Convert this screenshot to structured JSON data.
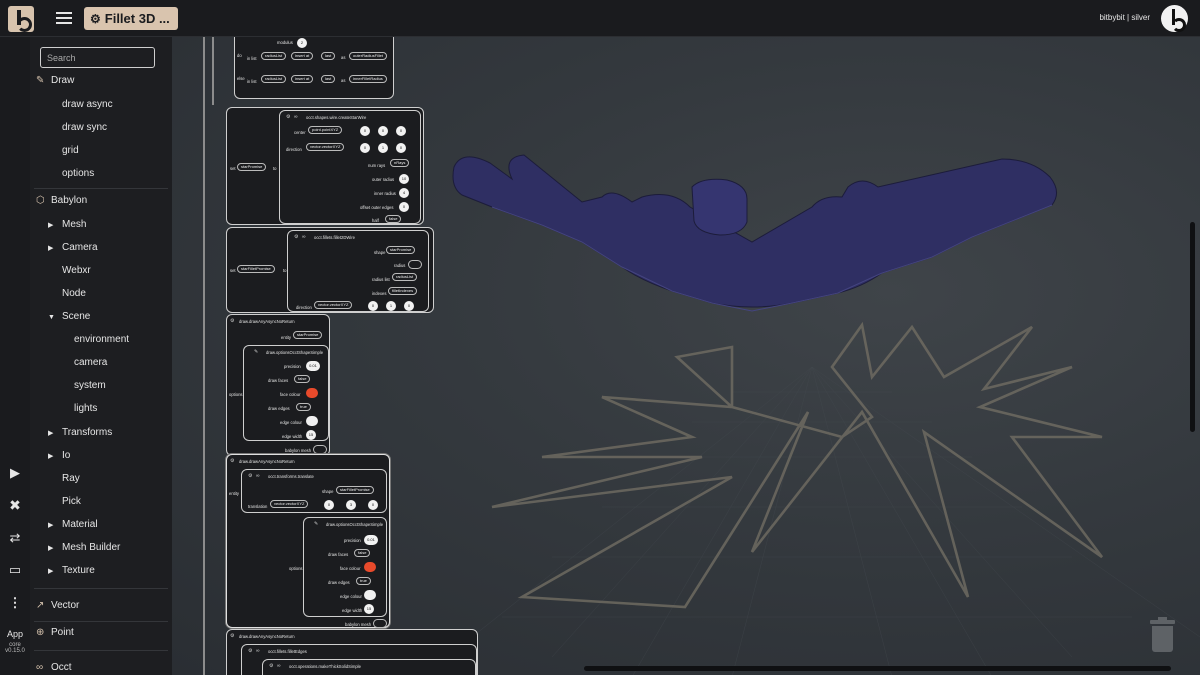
{
  "header": {
    "app_title": "Fillet 3D ...",
    "user": "bitbybit | silver"
  },
  "rail": {
    "app_label": "App",
    "core_label": "core",
    "version": "v0.15.0"
  },
  "sidebar": {
    "search_placeholder": "Search",
    "items": [
      {
        "label": "Draw"
      },
      {
        "label": "draw async"
      },
      {
        "label": "draw sync"
      },
      {
        "label": "grid"
      },
      {
        "label": "options"
      },
      {
        "label": "Babylon"
      },
      {
        "label": "Mesh"
      },
      {
        "label": "Camera"
      },
      {
        "label": "Webxr"
      },
      {
        "label": "Node"
      },
      {
        "label": "Scene"
      },
      {
        "label": "environment"
      },
      {
        "label": "camera"
      },
      {
        "label": "system"
      },
      {
        "label": "lights"
      },
      {
        "label": "Transforms"
      },
      {
        "label": "Io"
      },
      {
        "label": "Ray"
      },
      {
        "label": "Pick"
      },
      {
        "label": "Material"
      },
      {
        "label": "Mesh Builder"
      },
      {
        "label": "Texture"
      },
      {
        "label": "Vector"
      },
      {
        "label": "Point"
      },
      {
        "label": "Occt"
      }
    ]
  },
  "blocks": {
    "modulus": "modulus",
    "in_list": "in list",
    "insert_at": "insert at",
    "last": "last",
    "as": "as",
    "outer_radius_fillet": "outerRadiusFillet",
    "radius_list": "radiusList",
    "inner_radius_fillet": "innerFilletRadius",
    "do": "do",
    "else": "else",
    "set": "set",
    "to": "to",
    "star_promise": "starPromise",
    "create_star_wire": "occt.shapes.wire.createStarWire",
    "center": "center",
    "point_xyz": "point.pointXYZ",
    "direction": "direction",
    "vector_xyz": "vector.vectorXYZ",
    "num_rays": "num rays",
    "num_rays_val": "nRays",
    "outer_radius": "outer radius",
    "inner_radius": "inner radius",
    "offset_outer_edges": "offset outer edges",
    "half": "half",
    "half_val": "false",
    "star_fillet_promise": "starFilletPromise",
    "fillet_2d_wire": "occt.fillets.fillet2DWire",
    "shape": "shape",
    "radius": "radius",
    "radius_list_label": "radius list",
    "radius_list_val": "radiusList",
    "indexes": "indexes",
    "indexes_val": "filletIndexes",
    "draw_any_async": "draw.drawAnyAsyncNoReturn",
    "entity": "entity",
    "options": "options",
    "draw_options": "draw.optionsOcctShapeSimple",
    "precision": "precision",
    "precision_val": "0.01",
    "draw_faces": "draw faces",
    "false_val": "false",
    "true_val": "true",
    "face_colour": "face colour",
    "draw_edges": "draw edges",
    "edge_colour": "edge colour",
    "edge_width": "edge width",
    "edge_width_val": "15",
    "babylon_mesh": "babylon mesh",
    "transforms_translate": "occt.transforms.translate",
    "translation": "translation",
    "fillet_edges": "occt.fillets.filletEdges",
    "make_thick_solid": "occt.operations.makeThickSolidSimple",
    "n0": "0",
    "n1": "1",
    "n2": "2",
    "n3": "3",
    "n4": "4",
    "n10": "10"
  },
  "colors": {
    "accent": "#d9c4ae",
    "face_colour": "#e84a2b",
    "model": "#2f2f63"
  }
}
